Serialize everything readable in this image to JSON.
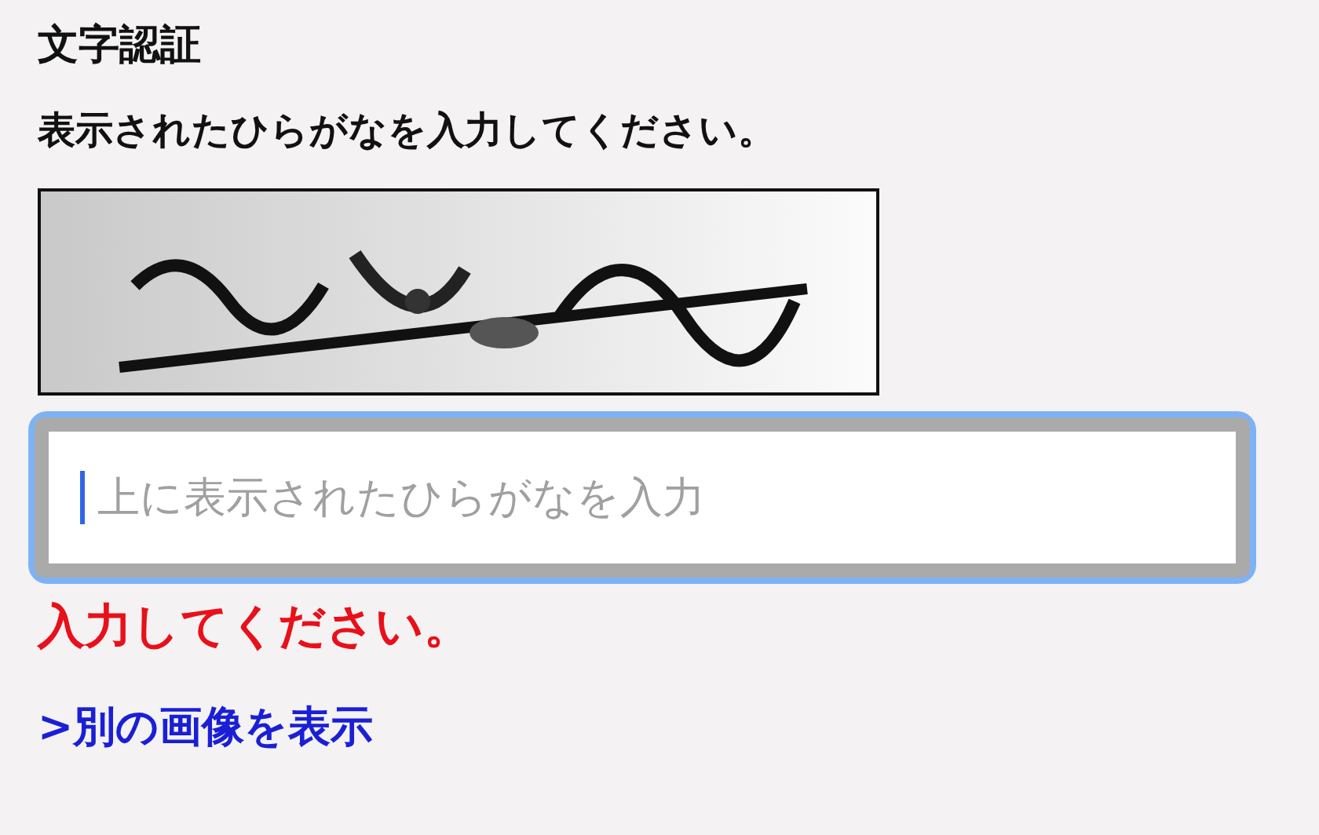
{
  "title": "文字認証",
  "instruction": "表示されたひらがなを入力してください。",
  "answer": {
    "placeholder": "上に表示されたひらがなを入力",
    "focused": true
  },
  "error": "入力してください。",
  "link": ">別の画像を表示"
}
